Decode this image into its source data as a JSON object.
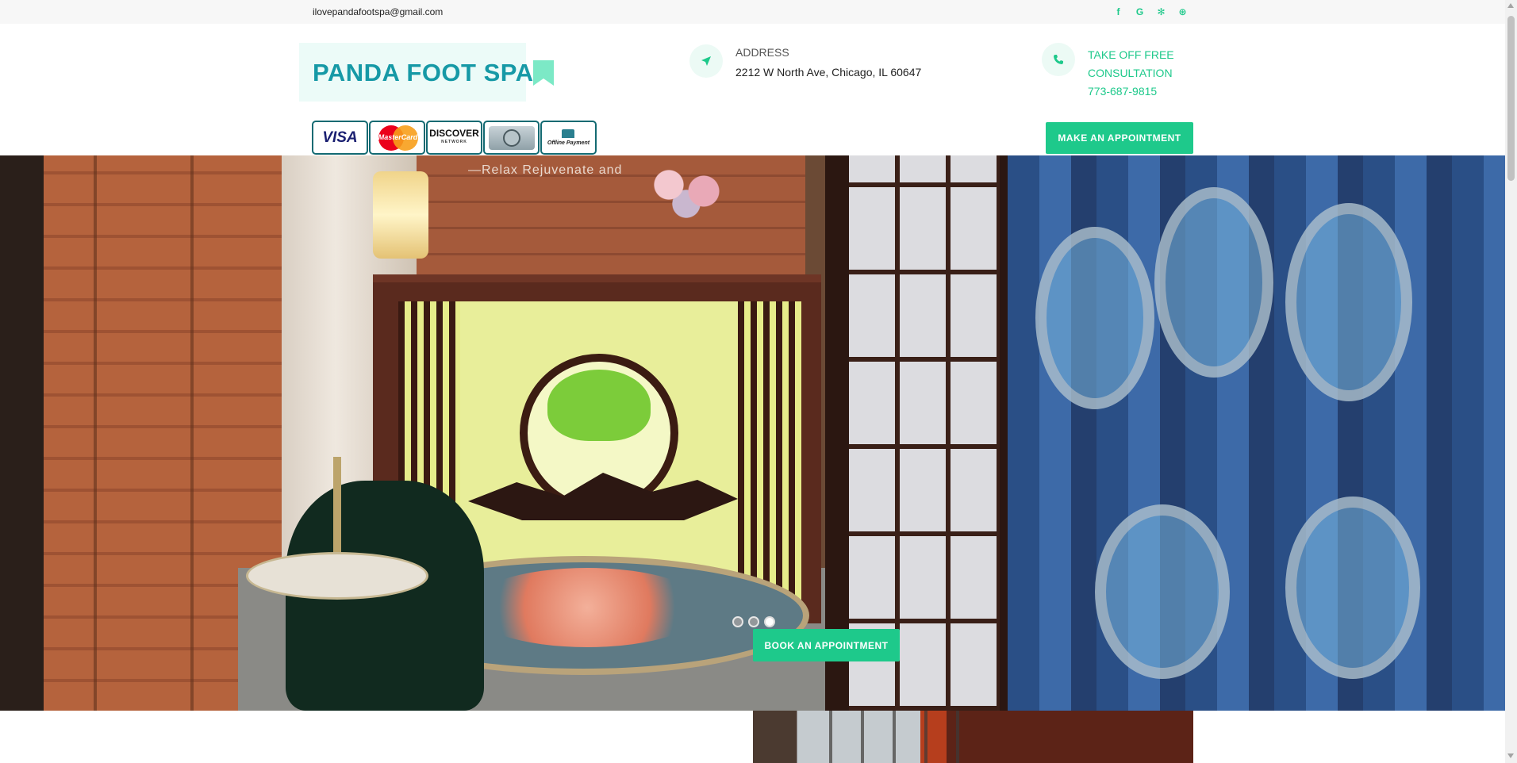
{
  "topbar": {
    "email": "ilovepandafootspa@gmail.com",
    "social": [
      {
        "icon": "facebook-icon",
        "glyph": "f"
      },
      {
        "icon": "google-icon",
        "glyph": "G"
      },
      {
        "icon": "yelp-icon",
        "glyph": "✻"
      },
      {
        "icon": "tripadvisor-icon",
        "glyph": "⊛"
      }
    ]
  },
  "header": {
    "logo": "PANDA FOOT SPA",
    "address_label": "ADDRESS",
    "address_value": "2212 W North Ave, Chicago, IL 60647",
    "consult_label": "TAKE OFF FREE CONSULTATION",
    "phone": "773-687-9815",
    "appointment_button": "MAKE AN APPOINTMENT"
  },
  "payments": {
    "visa": "VISA",
    "mastercard": "MasterCard",
    "discover": "DISCOVER",
    "discover_sub": "NETWORK",
    "offline": "Offline Payment"
  },
  "hero": {
    "sign_text": "—Relax  Rejuvenate and",
    "book_button": "BOOK AN APPOINTMENT",
    "slides": 3,
    "active_slide": 3
  },
  "colors": {
    "accent": "#1ec98b",
    "logo": "#1699a6",
    "payment_border": "#136a72"
  }
}
